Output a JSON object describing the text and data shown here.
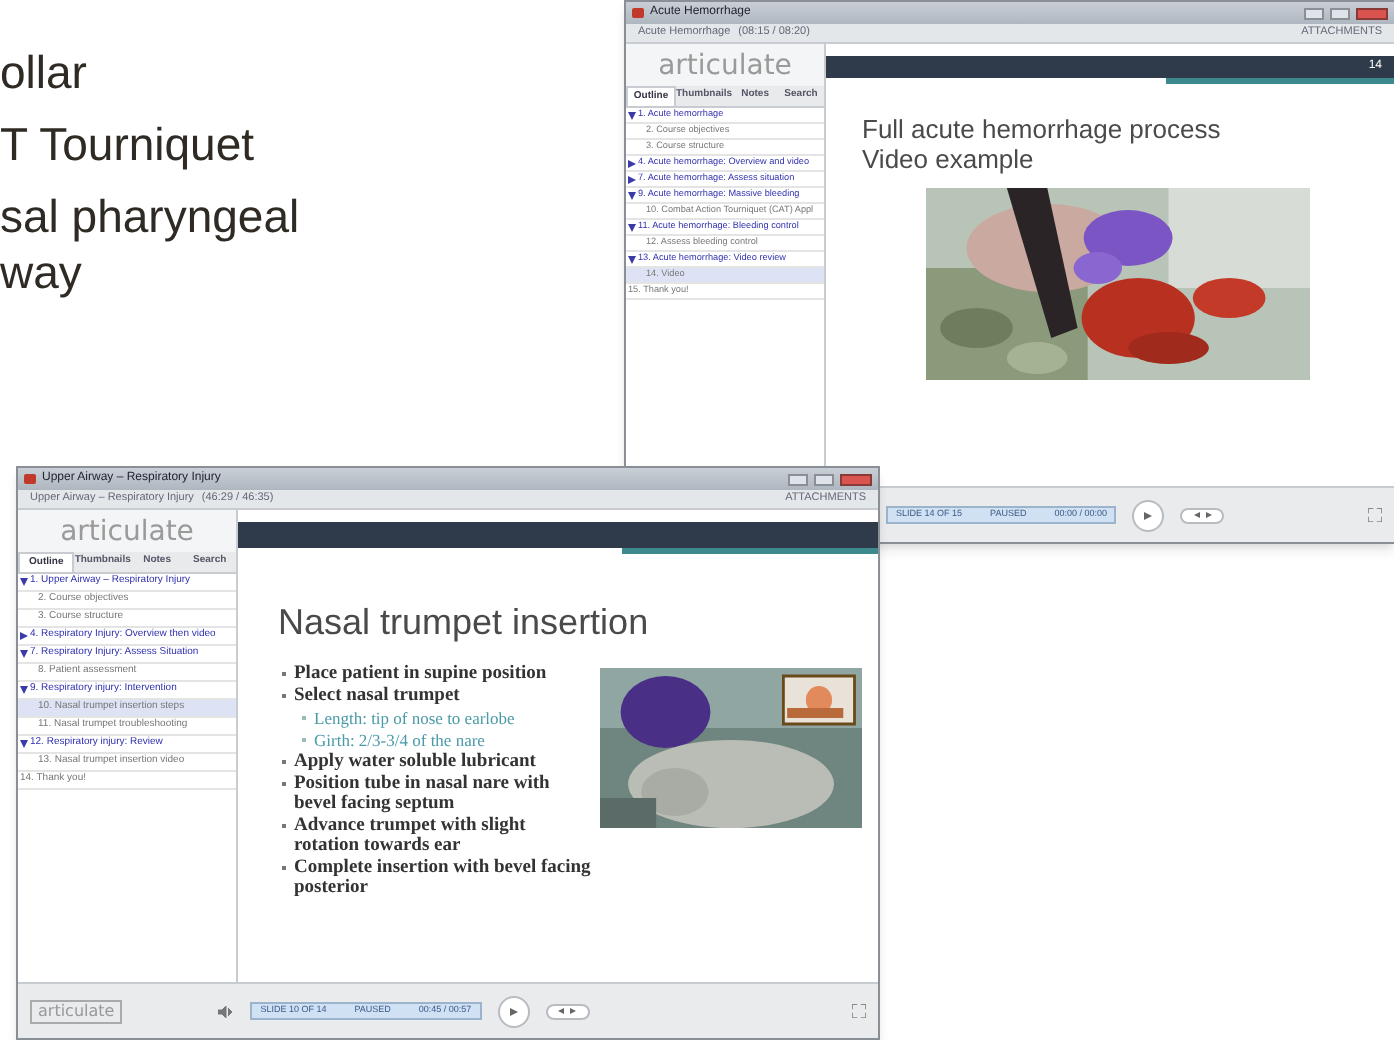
{
  "slide_bullets": [
    {
      "lines": [
        "ollar"
      ]
    },
    {
      "lines": [
        "T Tourniquet"
      ]
    },
    {
      "lines": [
        "sal pharyngeal",
        "way"
      ]
    }
  ],
  "windows": [
    {
      "title": "Acute Hemorrhage",
      "course_title": "Acute Hemorrhage",
      "course_time": "(08:15 / 08:20)",
      "attachments": "ATTACHMENTS",
      "logo": "articulate",
      "tabs": [
        {
          "label": "Outline",
          "selected": true
        },
        {
          "label": "Thumbnails",
          "selected": false
        },
        {
          "label": "Notes",
          "selected": false
        },
        {
          "label": "Search",
          "selected": false
        }
      ],
      "outline": [
        {
          "label": "1. Acute hemorrhage",
          "selected": false,
          "expanded": true,
          "children": [
            {
              "label": "2. Course objectives",
              "selected": false
            },
            {
              "label": "3. Course structure",
              "selected": false
            }
          ]
        },
        {
          "label": "4. Acute hemorrhage: Overview and video",
          "selected": false,
          "expanded": false
        },
        {
          "label": "7. Acute hemorrhage: Assess situation",
          "selected": false,
          "expanded": false
        },
        {
          "label": "9. Acute hemorrhage: Massive bleeding",
          "selected": false,
          "expanded": true,
          "children": [
            {
              "label": "10. Combat Action Tourniquet (CAT) Appl",
              "selected": false
            }
          ]
        },
        {
          "label": "11. Acute hemorrhage: Bleeding control",
          "selected": false,
          "expanded": true,
          "children": [
            {
              "label": "12. Assess bleeding control",
              "selected": false
            }
          ]
        },
        {
          "label": "13. Acute hemorrhage: Video review",
          "selected": false,
          "expanded": true,
          "children": [
            {
              "label": "14. Video",
              "selected": true
            }
          ]
        },
        {
          "label": "15. Thank you!",
          "selected": false
        }
      ],
      "slide": {
        "number": "14",
        "title_lines": [
          "Full acute hemorrhage process",
          "Video example"
        ],
        "media": {
          "kind": "picture"
        }
      },
      "controls": {
        "slide_counter": "SLIDE 14 OF 15",
        "status": "PAUSED",
        "time": "00:00 / 00:00"
      }
    },
    {
      "title": "Upper Airway – Respiratory Injury",
      "course_title": "Upper Airway – Respiratory Injury",
      "course_time": "(46:29 / 46:35)",
      "attachments": "ATTACHMENTS",
      "logo": "articulate",
      "tabs": [
        {
          "label": "Outline",
          "selected": true
        },
        {
          "label": "Thumbnails",
          "selected": false
        },
        {
          "label": "Notes",
          "selected": false
        },
        {
          "label": "Search",
          "selected": false
        }
      ],
      "outline": [
        {
          "label": "1. Upper Airway – Respiratory Injury",
          "selected": false,
          "expanded": true,
          "children": [
            {
              "label": "2. Course objectives",
              "selected": false
            },
            {
              "label": "3. Course structure",
              "selected": false
            }
          ]
        },
        {
          "label": "4. Respiratory Injury: Overview then video",
          "selected": false,
          "expanded": false
        },
        {
          "label": "7. Respiratory Injury: Assess Situation",
          "selected": false,
          "expanded": true,
          "children": [
            {
              "label": "8. Patient assessment",
              "selected": false
            }
          ]
        },
        {
          "label": "9. Respiratory injury: Intervention",
          "selected": false,
          "expanded": true,
          "children": [
            {
              "label": "10. Nasal trumpet insertion steps",
              "selected": true
            },
            {
              "label": "11. Nasal trumpet troubleshooting",
              "selected": false
            }
          ]
        },
        {
          "label": "12. Respiratory injury: Review",
          "selected": false,
          "expanded": true,
          "children": [
            {
              "label": "13. Nasal trumpet insertion video",
              "selected": false
            }
          ]
        },
        {
          "label": "14. Thank you!",
          "selected": false
        }
      ],
      "slide": {
        "title_lines": [
          "Nasal trumpet insertion"
        ],
        "bullets": [
          {
            "text": "Place patient in supine position"
          },
          {
            "text": "Select nasal trumpet",
            "children": [
              {
                "text": "Length: tip of nose to earlobe"
              },
              {
                "text": "Girth: 2/3-3/4 of the nare"
              }
            ]
          },
          {
            "text": "Apply water soluble lubricant"
          },
          {
            "text": "Position tube in nasal nare with bevel facing septum"
          },
          {
            "text": "Advance trumpet with slight rotation towards ear"
          },
          {
            "text": "Complete insertion with bevel facing posterior"
          }
        ],
        "media": {
          "kind": "picture"
        }
      },
      "controls": {
        "logo": "articulate",
        "slide_counter": "SLIDE 10 OF 14",
        "status": "PAUSED",
        "time": "00:45 / 00:57"
      }
    }
  ]
}
